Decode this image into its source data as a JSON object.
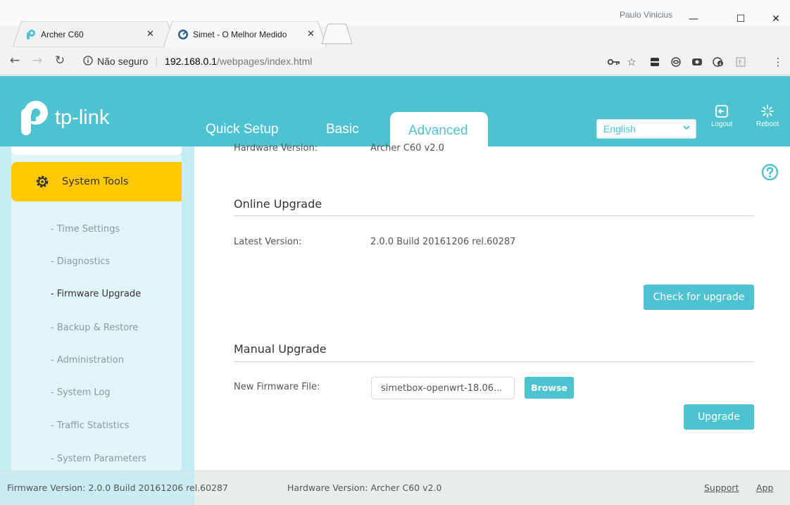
{
  "browser": {
    "tabs": [
      {
        "title": "Archer C60",
        "active": true
      },
      {
        "title": "Simet - O Melhor Medido",
        "active": false
      }
    ],
    "profile_name": "Paulo Vinicius",
    "window_buttons": {
      "minimize": "—",
      "maximize": "☐",
      "close": "✕"
    },
    "address": {
      "security_label": "Não seguro",
      "host": "192.168.0.1",
      "path": "/webpages/index.html"
    }
  },
  "router": {
    "logo_text": "tp-link",
    "nav": {
      "quick_setup": "Quick Setup",
      "basic": "Basic",
      "advanced": "Advanced"
    },
    "language": {
      "selected": "English"
    },
    "actions": {
      "logout": "Logout",
      "reboot": "Reboot"
    }
  },
  "sidebar": {
    "section": "System Tools",
    "items": [
      {
        "label": "- Time Settings",
        "active": false
      },
      {
        "label": "- Diagnostics",
        "active": false
      },
      {
        "label": "- Firmware Upgrade",
        "active": true
      },
      {
        "label": "- Backup & Restore",
        "active": false
      },
      {
        "label": "- Administration",
        "active": false
      },
      {
        "label": "- System Log",
        "active": false
      },
      {
        "label": "- Traffic Statistics",
        "active": false
      },
      {
        "label": "- System Parameters",
        "active": false
      }
    ]
  },
  "main": {
    "hardware_version_label": "Hardware Version:",
    "hardware_version_value": "Archer C60 v2.0",
    "online_upgrade": {
      "title": "Online Upgrade",
      "latest_version_label": "Latest Version:",
      "latest_version_value": "2.0.0 Build 20161206 rel.60287",
      "check_button": "Check for upgrade"
    },
    "manual_upgrade": {
      "title": "Manual Upgrade",
      "file_label": "New Firmware File:",
      "file_value": "simetbox-openwrt-18.06...",
      "browse_button": "Browse",
      "upgrade_button": "Upgrade"
    }
  },
  "footer": {
    "firmware_version": "Firmware Version: 2.0.0 Build 20161206 rel.60287",
    "hardware_version": "Hardware Version: Archer C60 v2.0",
    "support": "Support",
    "app": "App"
  },
  "colors": {
    "brand": "#4dc2d1",
    "sidebar_active": "#ffc800",
    "sidebar_bg": "#c4ecf2"
  }
}
